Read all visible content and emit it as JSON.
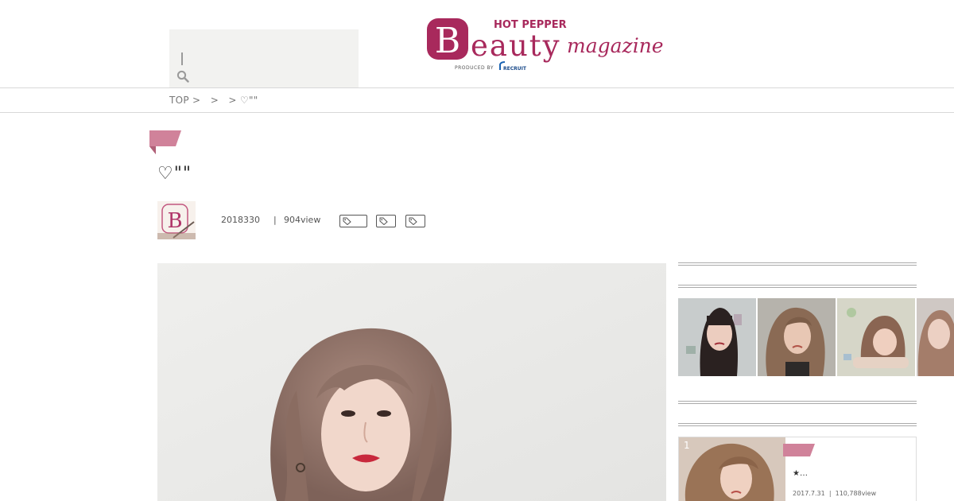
{
  "header": {
    "logo": {
      "brand_top": "HOT PEPPER",
      "brand_letter": "B",
      "brand_main": "eauty",
      "brand_sub": "magazine",
      "produced_by": "PRODUCED BY",
      "company": "RECRUIT",
      "color": "#a8295c"
    }
  },
  "breadcrumb": {
    "text": "TOP >   >   > ♡\"\""
  },
  "article": {
    "title": "♡\"\"",
    "date": "2018330",
    "separator": "|",
    "views": "904view",
    "tag_count": 3,
    "accent_color": "#d0829a"
  },
  "sidebar": {
    "ranking": [
      {
        "rank": "1",
        "title": "★…",
        "date": "2017.7.31",
        "separator": "|",
        "views": "110,788view"
      }
    ]
  }
}
